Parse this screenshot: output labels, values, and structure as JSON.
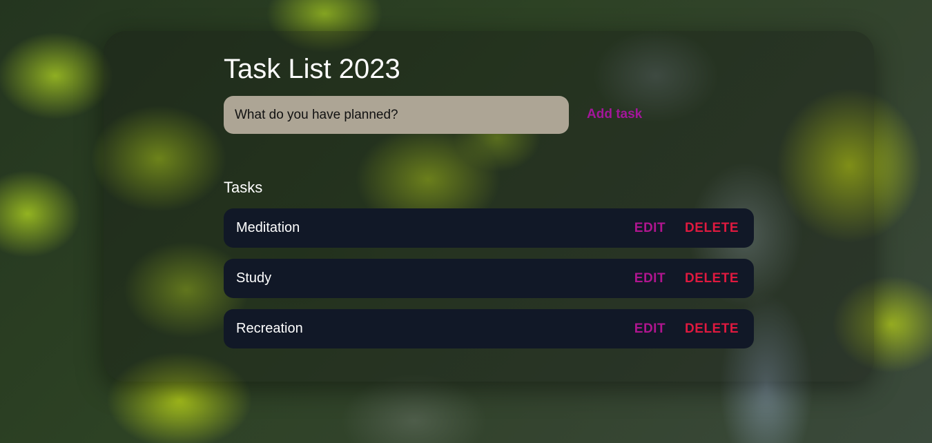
{
  "header": {
    "title": "Task List 2023"
  },
  "new_task": {
    "placeholder": "What do you have planned?",
    "value": "",
    "add_label": "Add task"
  },
  "tasks_section": {
    "heading": "Tasks",
    "items": [
      {
        "label": "Meditation",
        "edit_label": "EDIT",
        "delete_label": "DELETE"
      },
      {
        "label": "Study",
        "edit_label": "EDIT",
        "delete_label": "DELETE"
      },
      {
        "label": "Recreation",
        "edit_label": "EDIT",
        "delete_label": "DELETE"
      }
    ]
  },
  "colors": {
    "input_background": "#ada595",
    "task_background": "#111827",
    "add_task": "#a3169a",
    "edit": "#b0158f",
    "delete": "#e0193f"
  }
}
